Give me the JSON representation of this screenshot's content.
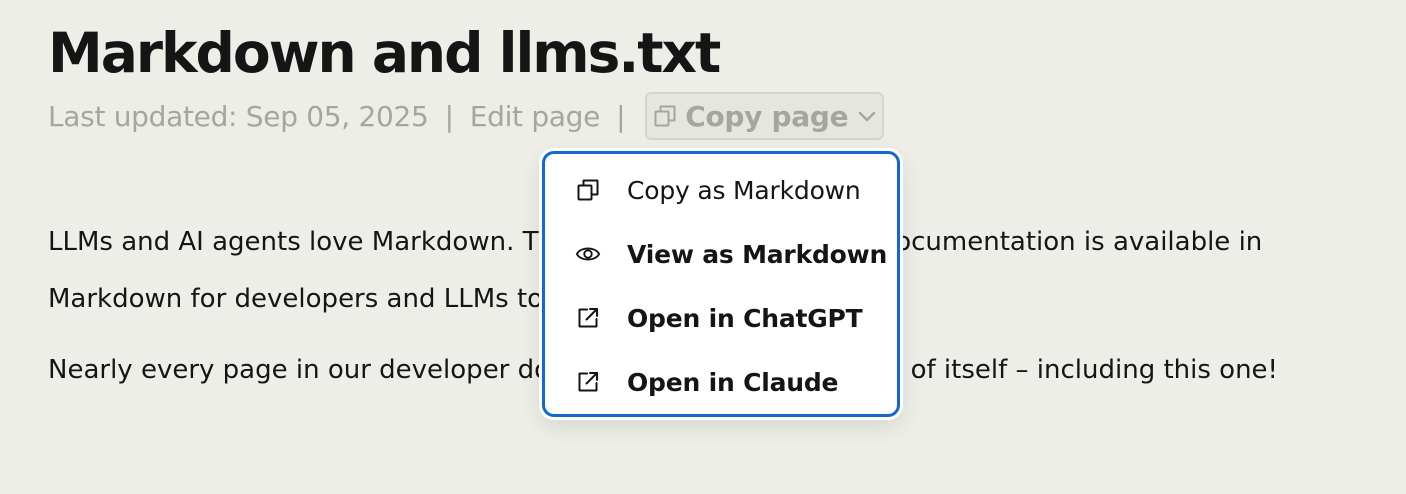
{
  "page": {
    "title": "Markdown and llms.txt",
    "meta": {
      "last_updated": "Last updated: Sep 05, 2025",
      "separator": "|",
      "edit_label": "Edit page",
      "copy_label": "Copy page"
    },
    "paragraphs": [
      "LLMs and AI agents love Markdown. That's why all of PostHog's documentation is available in Markdown for developers and LLMs to consume.",
      "Nearly every page in our developer docs has a Markdown version of itself – including this one!"
    ]
  },
  "dropdown": {
    "items": [
      {
        "label": "Copy as Markdown",
        "icon": "copy-icon"
      },
      {
        "label": "View as Markdown",
        "icon": "eye-icon"
      },
      {
        "label": "Open in ChatGPT",
        "icon": "external-link-icon"
      },
      {
        "label": "Open in Claude",
        "icon": "external-link-icon"
      }
    ]
  },
  "colors": {
    "background": "#eeeee9",
    "text": "#151515",
    "muted": "#a5a6a0",
    "focus_ring": "#1467d1"
  }
}
